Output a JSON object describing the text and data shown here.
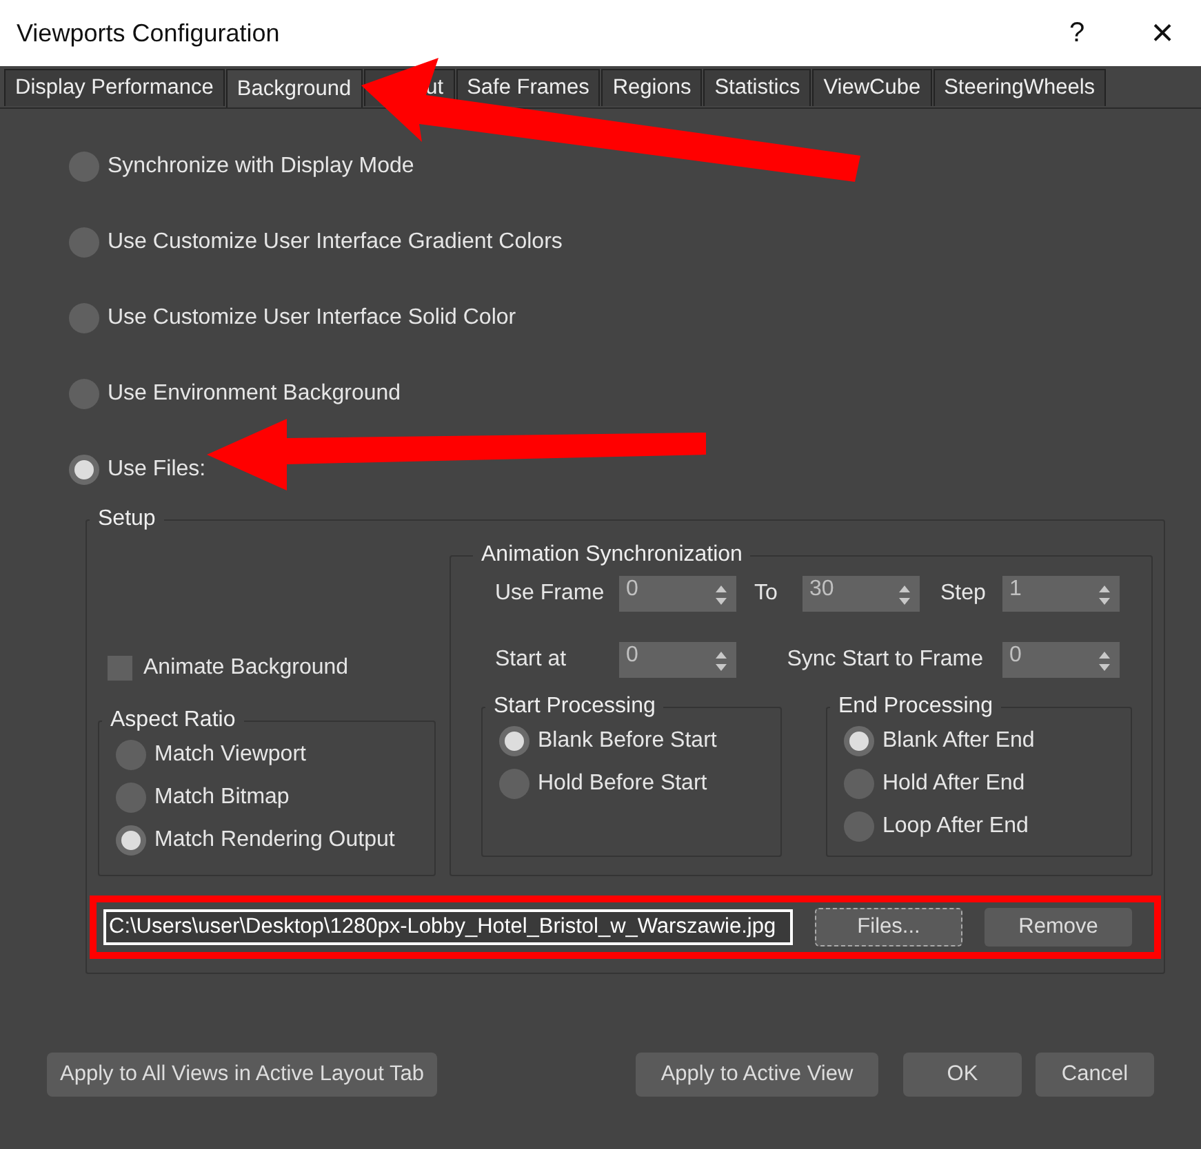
{
  "window": {
    "title": "Viewports Configuration",
    "help": "?",
    "close": "×"
  },
  "tabs": [
    {
      "label": "Display Performance",
      "selected": false
    },
    {
      "label": "Background",
      "selected": true
    },
    {
      "label": "ut",
      "selected": false
    },
    {
      "label": "Safe Frames",
      "selected": false
    },
    {
      "label": "Regions",
      "selected": false
    },
    {
      "label": "Statistics",
      "selected": false
    },
    {
      "label": "ViewCube",
      "selected": false
    },
    {
      "label": "SteeringWheels",
      "selected": false
    }
  ],
  "background_options": [
    {
      "label": "Synchronize with Display Mode",
      "selected": false
    },
    {
      "label": "Use Customize User Interface Gradient Colors",
      "selected": false
    },
    {
      "label": "Use Customize User Interface Solid Color",
      "selected": false
    },
    {
      "label": "Use Environment Background",
      "selected": false
    },
    {
      "label": "Use Files:",
      "selected": true
    }
  ],
  "setup": {
    "title": "Setup",
    "animate_background": {
      "label": "Animate Background",
      "checked": false
    },
    "aspect_ratio": {
      "title": "Aspect Ratio",
      "options": [
        {
          "label": "Match Viewport",
          "selected": false
        },
        {
          "label": "Match Bitmap",
          "selected": false
        },
        {
          "label": "Match Rendering Output",
          "selected": true
        }
      ]
    },
    "animation_sync": {
      "title": "Animation Synchronization",
      "rows": [
        [
          {
            "label": "Use Frame",
            "value": "0"
          },
          {
            "label": "To",
            "value": "30"
          },
          {
            "label": "Step",
            "value": "1"
          }
        ],
        [
          {
            "label": "Start at",
            "value": "0"
          },
          {
            "label": "Sync Start to Frame",
            "value": "0"
          }
        ]
      ],
      "start_processing": {
        "title": "Start Processing",
        "options": [
          {
            "label": "Blank Before Start",
            "selected": true
          },
          {
            "label": "Hold Before Start",
            "selected": false
          }
        ]
      },
      "end_processing": {
        "title": "End Processing",
        "options": [
          {
            "label": "Blank After End",
            "selected": true
          },
          {
            "label": "Hold After End",
            "selected": false
          },
          {
            "label": "Loop After End",
            "selected": false
          }
        ]
      }
    },
    "file": {
      "path": "C:\\Users\\user\\Desktop\\1280px-Lobby_Hotel_Bristol_w_Warszawie.jpg",
      "buttons": [
        {
          "label": "Files...",
          "focused": true
        },
        {
          "label": "Remove",
          "focused": false
        }
      ]
    }
  },
  "footer_buttons": [
    "Apply to All Views in Active Layout Tab",
    "Apply to Active View",
    "OK",
    "Cancel"
  ],
  "annotations": [
    {
      "kind": "arrow"
    },
    {
      "kind": "arrow"
    },
    {
      "kind": "highlight"
    }
  ]
}
